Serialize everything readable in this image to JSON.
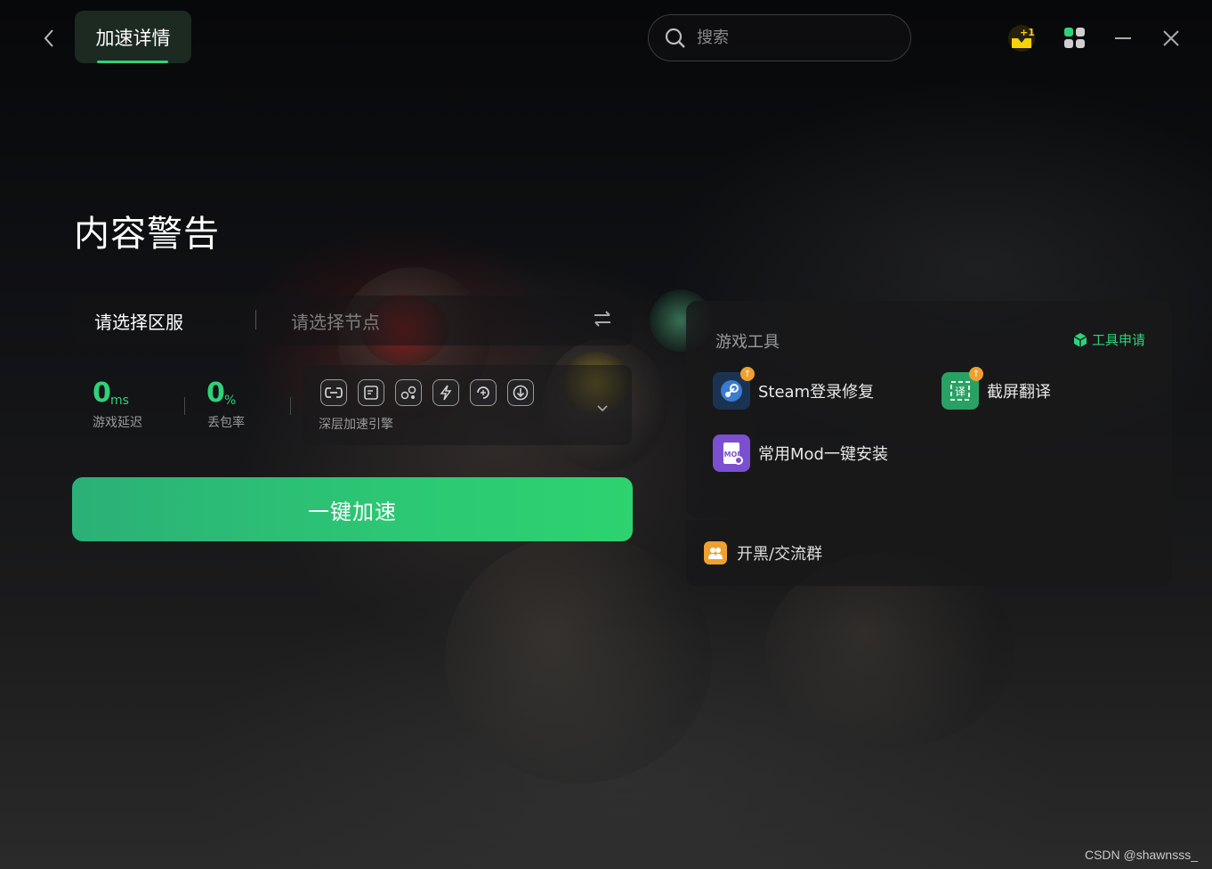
{
  "header": {
    "tab_label": "加速详情",
    "search_placeholder": "搜索"
  },
  "game": {
    "title": "内容警告"
  },
  "selector": {
    "region_label": "请选择区服",
    "node_label": "请选择节点"
  },
  "stats": {
    "latency_value": "0",
    "latency_unit": "ms",
    "latency_label": "游戏延迟",
    "loss_value": "0",
    "loss_unit": "%",
    "loss_label": "丢包率"
  },
  "engine": {
    "label": "深层加速引擎",
    "icons": [
      "link-icon",
      "screen-icon",
      "network-icon",
      "lightning-icon",
      "refresh-icon",
      "download-icon"
    ]
  },
  "accelerate_label": "一键加速",
  "tools": {
    "title": "游戏工具",
    "apply_label": "工具申请",
    "items": [
      {
        "label": "Steam登录修复",
        "icon": "steam-icon"
      },
      {
        "label": "截屏翻译",
        "icon": "translate-icon"
      },
      {
        "label": "常用Mod一键安装",
        "icon": "mod-icon"
      }
    ]
  },
  "group": {
    "label": "开黑/交流群"
  },
  "watermark": "CSDN @shawnsss_",
  "colors": {
    "accent": "#2fd27a",
    "badge": "#f0a030",
    "notify": "#f5d20a"
  }
}
